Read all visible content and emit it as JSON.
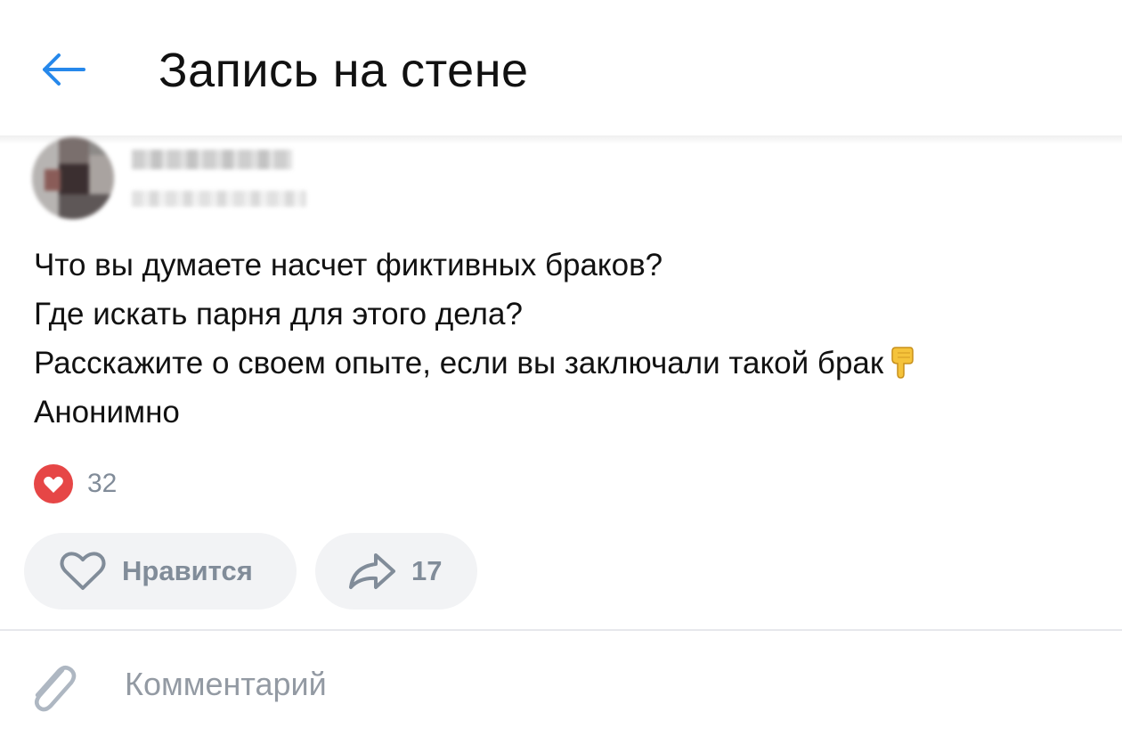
{
  "header": {
    "title": "Запись на стене",
    "back_icon": "arrow-left-icon",
    "accent_color": "#2688eb"
  },
  "post": {
    "lines": [
      "Что вы думаете насчет фиктивных браков?",
      "Где искать парня для этого дела?",
      "Расскажите о своем опыте, если вы заключали такой брак",
      "Анонимно"
    ],
    "emoji": "pointing-down-hand-emoji"
  },
  "reactions": {
    "icon": "heart-reaction-icon",
    "count": "32",
    "color": "#e64646"
  },
  "actions": {
    "like_label": "Нравится",
    "like_icon": "heart-outline-icon",
    "share_count": "17",
    "share_icon": "share-arrow-icon"
  },
  "comment": {
    "placeholder": "Комментарий",
    "attach_icon": "paperclip-icon"
  }
}
